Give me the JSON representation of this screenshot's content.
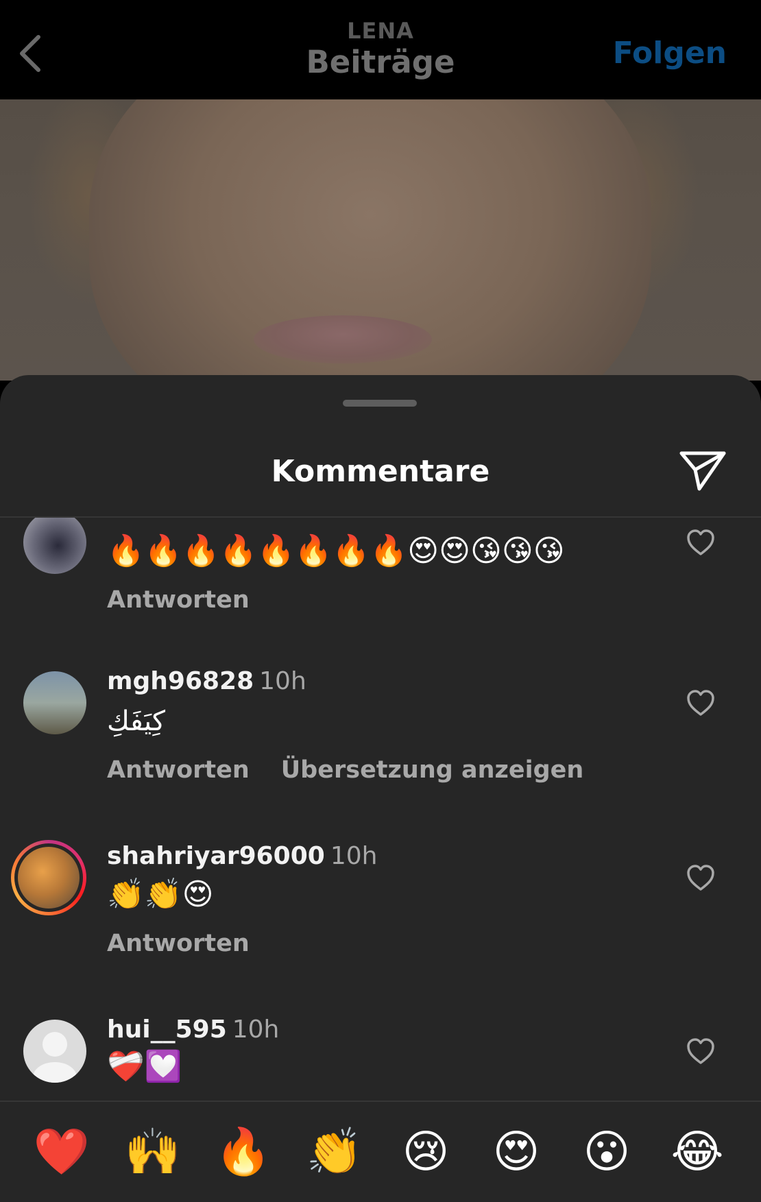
{
  "header": {
    "owner": "LENA",
    "title": "Beiträge",
    "follow_label": "Folgen"
  },
  "sheet": {
    "title": "Kommentare"
  },
  "comments": [
    {
      "username": "",
      "time": "",
      "text": "🔥🔥🔥🔥🔥🔥🔥🔥😍😍😘😘😘",
      "actions": [
        "Antworten"
      ]
    },
    {
      "username": "mgh96828",
      "time": "10h",
      "text": "كِيَفَكِ",
      "actions": [
        "Antworten",
        "Übersetzung anzeigen"
      ]
    },
    {
      "username": "shahriyar96000",
      "time": "10h",
      "text": "👏👏😍",
      "actions": [
        "Antworten"
      ]
    },
    {
      "username": "hui__595",
      "time": "10h",
      "text": "❤️‍🩹💟",
      "actions": []
    }
  ],
  "quick_reactions": [
    "❤️",
    "🙌",
    "🔥",
    "👏",
    "😢",
    "😍",
    "😮",
    "😂"
  ],
  "icons": {
    "back": "chevron-left-icon",
    "share": "paper-plane-icon",
    "like": "heart-outline-icon"
  },
  "colors": {
    "follow": "#0c4d83",
    "sheet_bg": "#262626",
    "secondary_text": "#a8a8a8"
  }
}
